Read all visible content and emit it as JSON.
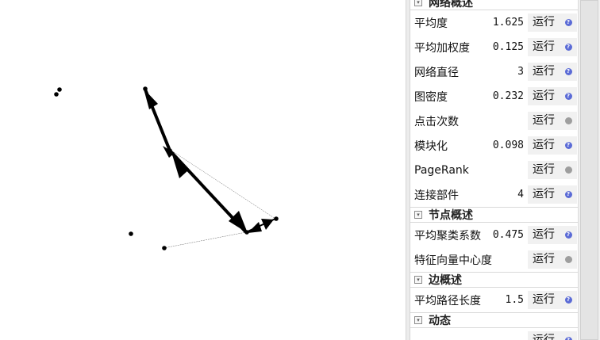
{
  "panel": {
    "sections": [
      {
        "title": "网络概述",
        "rows": [
          {
            "label": "平均度",
            "value": "1.625",
            "button": "运行",
            "status": "help"
          },
          {
            "label": "平均加权度",
            "value": "0.125",
            "button": "运行",
            "status": "help"
          },
          {
            "label": "网络直径",
            "value": "3",
            "button": "运行",
            "status": "help"
          },
          {
            "label": "图密度",
            "value": "0.232",
            "button": "运行",
            "status": "help"
          },
          {
            "label": "点击次数",
            "value": "",
            "button": "运行",
            "status": "disabled"
          },
          {
            "label": "模块化",
            "value": "0.098",
            "button": "运行",
            "status": "help"
          },
          {
            "label": "PageRank",
            "value": "",
            "button": "运行",
            "status": "disabled"
          },
          {
            "label": "连接部件",
            "value": "4",
            "button": "运行",
            "status": "help"
          }
        ]
      },
      {
        "title": "节点概述",
        "rows": [
          {
            "label": "平均聚类系数",
            "value": "0.475",
            "button": "运行",
            "status": "help"
          },
          {
            "label": "特征向量中心度",
            "value": "",
            "button": "运行",
            "status": "disabled"
          }
        ]
      },
      {
        "title": "边概述",
        "rows": [
          {
            "label": "平均路径长度",
            "value": "1.5",
            "button": "运行",
            "status": "help"
          }
        ]
      },
      {
        "title": "动态",
        "rows": [
          {
            "label": "",
            "value": "",
            "button": "运行",
            "status": "help"
          }
        ]
      }
    ]
  },
  "graph": {
    "node_color": "#000000",
    "edge_color": "#000000"
  }
}
